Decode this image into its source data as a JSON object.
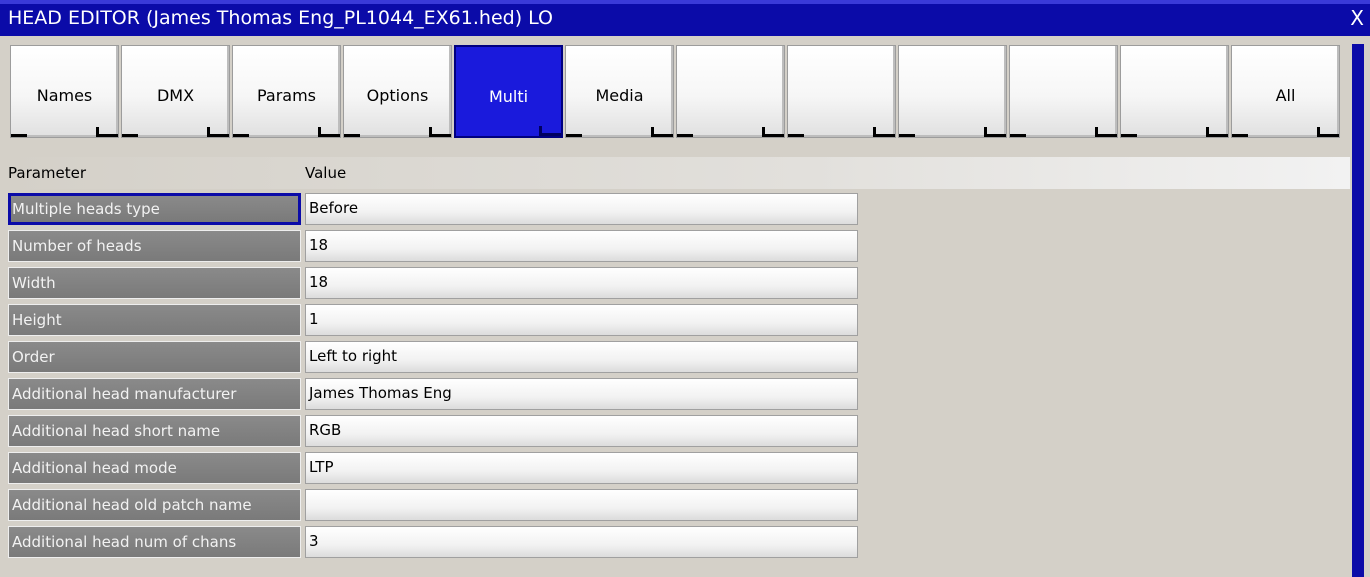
{
  "window": {
    "title": "HEAD EDITOR (James Thomas Eng_PL1044_EX61.hed) LO",
    "close_label": "X"
  },
  "tabs": [
    {
      "label": "Names",
      "active": false
    },
    {
      "label": "DMX",
      "active": false
    },
    {
      "label": "Params",
      "active": false
    },
    {
      "label": "Options",
      "active": false
    },
    {
      "label": "Multi",
      "active": true
    },
    {
      "label": "Media",
      "active": false
    },
    {
      "label": "",
      "active": false
    },
    {
      "label": "",
      "active": false
    },
    {
      "label": "",
      "active": false
    },
    {
      "label": "",
      "active": false
    },
    {
      "label": "",
      "active": false
    },
    {
      "label": "All",
      "active": false
    }
  ],
  "grid": {
    "headers": {
      "parameter": "Parameter",
      "value": "Value"
    },
    "rows": [
      {
        "parameter": "Multiple heads type",
        "value": "Before"
      },
      {
        "parameter": "Number of heads",
        "value": "18"
      },
      {
        "parameter": "Width",
        "value": "18"
      },
      {
        "parameter": "Height",
        "value": "1"
      },
      {
        "parameter": "Order",
        "value": "Left to right"
      },
      {
        "parameter": "Additional head manufacturer",
        "value": "James Thomas Eng"
      },
      {
        "parameter": "Additional head short name",
        "value": "RGB"
      },
      {
        "parameter": "Additional head mode",
        "value": "LTP"
      },
      {
        "parameter": "Additional head old patch name",
        "value": ""
      },
      {
        "parameter": "Additional head num of chans",
        "value": "3"
      }
    ]
  },
  "colors": {
    "titlebar": "#0b0ba8",
    "active_tab": "#1a1adc",
    "background": "#d4d0c8",
    "param_cell": "#808080"
  }
}
